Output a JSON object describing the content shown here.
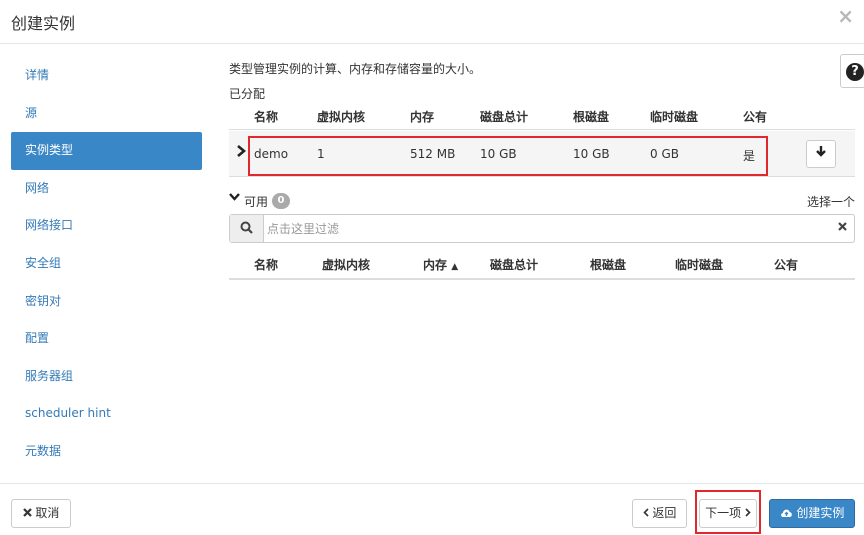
{
  "modal": {
    "title": "创建实例",
    "close": "×"
  },
  "sidebar": {
    "items": [
      {
        "label": "详情"
      },
      {
        "label": "源"
      },
      {
        "label": "实例类型",
        "active": true
      },
      {
        "label": "网络"
      },
      {
        "label": "网络接口"
      },
      {
        "label": "安全组"
      },
      {
        "label": "密钥对"
      },
      {
        "label": "配置"
      },
      {
        "label": "服务器组"
      },
      {
        "label": "scheduler hint"
      },
      {
        "label": "元数据"
      }
    ]
  },
  "content": {
    "description": "类型管理实例的计算、内存和存储容量的大小。",
    "help_icon": "?",
    "allocated": {
      "label": "已分配",
      "columns": [
        "名称",
        "虚拟内核",
        "内存",
        "磁盘总计",
        "根磁盘",
        "临时磁盘",
        "公有"
      ],
      "rows": [
        {
          "name": "demo",
          "vcpus": "1",
          "ram": "512 MB",
          "disk_total": "10 GB",
          "root_disk": "10 GB",
          "ephemeral": "0 GB",
          "public": "是"
        }
      ],
      "chevron": "›",
      "deallocate_icon": "↓"
    },
    "available": {
      "label": "可用",
      "count": "0",
      "select_hint": "选择一个",
      "filter_placeholder": "点击这里过滤",
      "columns": [
        "名称",
        "虚拟内核",
        "内存",
        "磁盘总计",
        "根磁盘",
        "临时磁盘",
        "公有"
      ],
      "sort_indicator": "▲"
    }
  },
  "footer": {
    "cancel": "取消",
    "back": "返回",
    "next": "下一项",
    "create": "创建实例"
  },
  "colors": {
    "primary": "#3a87c8",
    "link": "#337ab7",
    "highlight_border": "#e0282e",
    "badge": "#aaaaaa"
  }
}
